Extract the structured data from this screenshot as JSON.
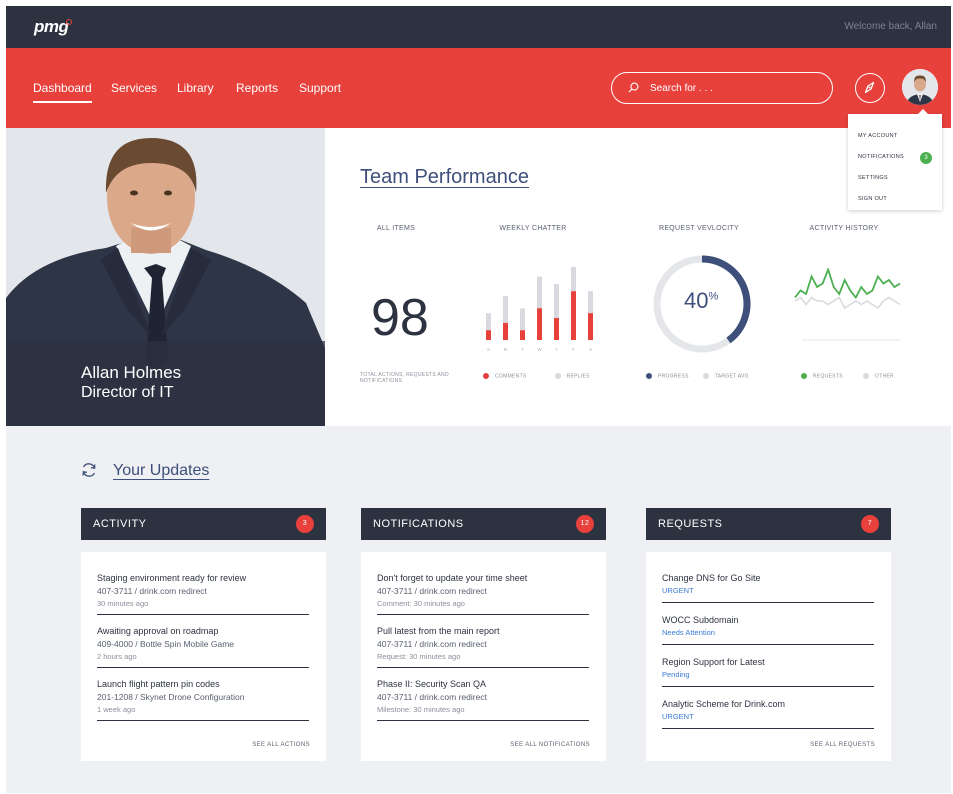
{
  "topbar": {
    "logo": "pmg",
    "welcome": "Welcome back, Allan"
  },
  "nav": {
    "items": [
      {
        "label": "Dashboard"
      },
      {
        "label": "Services"
      },
      {
        "label": "Library"
      },
      {
        "label": "Reports"
      },
      {
        "label": "Support"
      }
    ],
    "active": "Dashboard",
    "search_placeholder": "Search for . . ."
  },
  "user_menu": {
    "items": [
      {
        "label": "MY ACCOUNT"
      },
      {
        "label": "NOTIFICATIONS",
        "badge": "3"
      },
      {
        "label": "SETTINGS"
      },
      {
        "label": "SIGN OUT"
      }
    ]
  },
  "profile": {
    "name": "Allan Holmes",
    "title": "Director of IT"
  },
  "performance": {
    "title": "Team Performance",
    "all_items": {
      "label": "ALL ITEMS",
      "value": "98",
      "caption": "TOTAL ACTIONS, REQUESTS AND NOTIFICATIONS"
    },
    "weekly_chatter": {
      "label": "WEEKLY CHATTER",
      "legend": [
        "COMMENTS",
        "REPLIES"
      ]
    },
    "request_velocity": {
      "label": "REQUEST VEVLOCITY",
      "value": "40",
      "unit": "%",
      "legend": [
        "PROGRESS",
        "TARGET AVG"
      ]
    },
    "activity_history": {
      "label": "ACTIVITY HISTORY",
      "legend": [
        "REQUESTS",
        "OTHER"
      ]
    }
  },
  "colors": {
    "accent": "#e8413c",
    "dark": "#2d3240",
    "link": "#3d4f7a",
    "green": "#4caf50",
    "blue": "#3a7bd5"
  },
  "chart_data": [
    {
      "type": "bar",
      "title": "WEEKLY CHATTER",
      "categories": [
        "S",
        "M",
        "T",
        "W",
        "T",
        "F",
        "S"
      ],
      "series": [
        {
          "name": "COMMENTS",
          "values": [
            4,
            7,
            4,
            13,
            9,
            20,
            11
          ]
        },
        {
          "name": "REPLIES",
          "values": [
            11,
            18,
            13,
            26,
            23,
            30,
            20
          ]
        }
      ]
    },
    {
      "type": "pie",
      "title": "REQUEST VEVLOCITY",
      "series": [
        {
          "name": "PROGRESS",
          "values": [
            40
          ]
        },
        {
          "name": "TARGET AVG",
          "values": [
            60
          ]
        }
      ]
    },
    {
      "type": "line",
      "title": "ACTIVITY HISTORY",
      "series": [
        {
          "name": "REQUESTS",
          "values": [
            3,
            5,
            4,
            9,
            6,
            7,
            11,
            6,
            4,
            8,
            5,
            3,
            6,
            4,
            5,
            9,
            7,
            8,
            6,
            7
          ]
        },
        {
          "name": "OTHER",
          "values": [
            2,
            3,
            1,
            3,
            2,
            2,
            1,
            2,
            3,
            0,
            1,
            2,
            1,
            2,
            1,
            0,
            2,
            3,
            2,
            1
          ]
        }
      ]
    }
  ],
  "updates": {
    "title": "Your Updates",
    "activity": {
      "label": "ACTIVITY",
      "count": "3",
      "items": [
        {
          "title": "Staging environment ready for review",
          "sub": "407-3711 / drink.com redirect",
          "meta": "30 minutes ago"
        },
        {
          "title": "Awaiting approval on roadmap",
          "sub": "409-4000 / Bottle Spin Mobile Game",
          "meta": "2 hours ago"
        },
        {
          "title": "Launch flight pattern pin codes",
          "sub": "201-1208 / Skynet Drone Configuration",
          "meta": "1 week ago"
        }
      ],
      "see_all": "SEE ALL ACTIONS"
    },
    "notifications": {
      "label": "NOTIFICATIONS",
      "count": "12",
      "items": [
        {
          "title": "Don't forget to update your time sheet",
          "sub": "407-3711 / drink.com redirect",
          "meta": "Comment: 30 minutes ago"
        },
        {
          "title": "Pull latest from the main report",
          "sub": "407-3711 / drink.com redirect",
          "meta": "Request: 30 minutes ago"
        },
        {
          "title": "Phase II: Security Scan QA",
          "sub": "407-3711 / drink.com redirect",
          "meta": "Milestone: 30 minutes ago"
        }
      ],
      "see_all": "SEE ALL NOTIFICATIONS"
    },
    "requests": {
      "label": "REQUESTS",
      "count": "7",
      "items": [
        {
          "title": "Change DNS for Go Site",
          "status": "URGENT"
        },
        {
          "title": "WOCC Subdomain",
          "status": "Needs Attention"
        },
        {
          "title": "Region Support for Latest",
          "status": "Pending"
        },
        {
          "title": "Analytic Scheme for Drink.com",
          "status": "URGENT"
        }
      ],
      "see_all": "SEE ALL REQUESTS"
    }
  }
}
